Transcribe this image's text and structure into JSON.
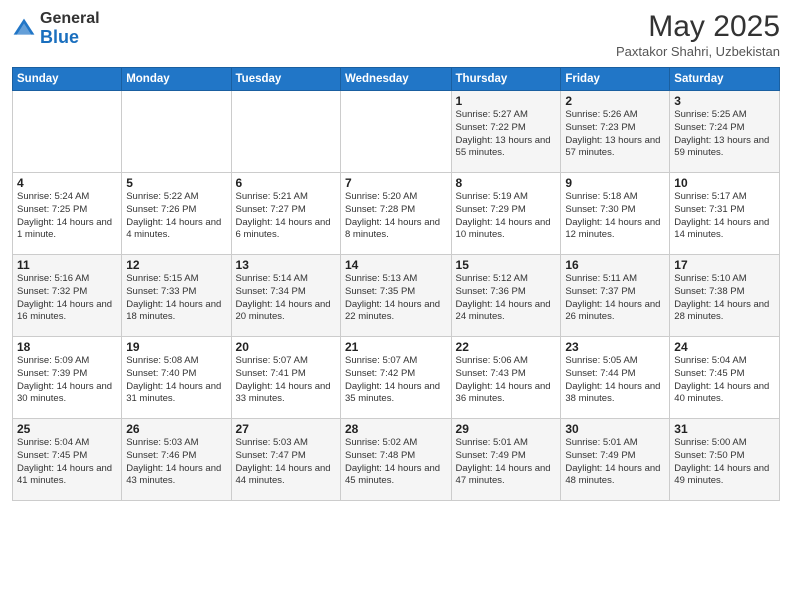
{
  "logo": {
    "general": "General",
    "blue": "Blue"
  },
  "title": "May 2025",
  "subtitle": "Paxtakor Shahri, Uzbekistan",
  "days_header": [
    "Sunday",
    "Monday",
    "Tuesday",
    "Wednesday",
    "Thursday",
    "Friday",
    "Saturday"
  ],
  "weeks": [
    [
      {
        "day": "",
        "sunrise": "",
        "sunset": "",
        "daylight": ""
      },
      {
        "day": "",
        "sunrise": "",
        "sunset": "",
        "daylight": ""
      },
      {
        "day": "",
        "sunrise": "",
        "sunset": "",
        "daylight": ""
      },
      {
        "day": "",
        "sunrise": "",
        "sunset": "",
        "daylight": ""
      },
      {
        "day": "1",
        "sunrise": "5:27 AM",
        "sunset": "7:22 PM",
        "daylight": "13 hours and 55 minutes."
      },
      {
        "day": "2",
        "sunrise": "5:26 AM",
        "sunset": "7:23 PM",
        "daylight": "13 hours and 57 minutes."
      },
      {
        "day": "3",
        "sunrise": "5:25 AM",
        "sunset": "7:24 PM",
        "daylight": "13 hours and 59 minutes."
      }
    ],
    [
      {
        "day": "4",
        "sunrise": "5:24 AM",
        "sunset": "7:25 PM",
        "daylight": "14 hours and 1 minute."
      },
      {
        "day": "5",
        "sunrise": "5:22 AM",
        "sunset": "7:26 PM",
        "daylight": "14 hours and 4 minutes."
      },
      {
        "day": "6",
        "sunrise": "5:21 AM",
        "sunset": "7:27 PM",
        "daylight": "14 hours and 6 minutes."
      },
      {
        "day": "7",
        "sunrise": "5:20 AM",
        "sunset": "7:28 PM",
        "daylight": "14 hours and 8 minutes."
      },
      {
        "day": "8",
        "sunrise": "5:19 AM",
        "sunset": "7:29 PM",
        "daylight": "14 hours and 10 minutes."
      },
      {
        "day": "9",
        "sunrise": "5:18 AM",
        "sunset": "7:30 PM",
        "daylight": "14 hours and 12 minutes."
      },
      {
        "day": "10",
        "sunrise": "5:17 AM",
        "sunset": "7:31 PM",
        "daylight": "14 hours and 14 minutes."
      }
    ],
    [
      {
        "day": "11",
        "sunrise": "5:16 AM",
        "sunset": "7:32 PM",
        "daylight": "14 hours and 16 minutes."
      },
      {
        "day": "12",
        "sunrise": "5:15 AM",
        "sunset": "7:33 PM",
        "daylight": "14 hours and 18 minutes."
      },
      {
        "day": "13",
        "sunrise": "5:14 AM",
        "sunset": "7:34 PM",
        "daylight": "14 hours and 20 minutes."
      },
      {
        "day": "14",
        "sunrise": "5:13 AM",
        "sunset": "7:35 PM",
        "daylight": "14 hours and 22 minutes."
      },
      {
        "day": "15",
        "sunrise": "5:12 AM",
        "sunset": "7:36 PM",
        "daylight": "14 hours and 24 minutes."
      },
      {
        "day": "16",
        "sunrise": "5:11 AM",
        "sunset": "7:37 PM",
        "daylight": "14 hours and 26 minutes."
      },
      {
        "day": "17",
        "sunrise": "5:10 AM",
        "sunset": "7:38 PM",
        "daylight": "14 hours and 28 minutes."
      }
    ],
    [
      {
        "day": "18",
        "sunrise": "5:09 AM",
        "sunset": "7:39 PM",
        "daylight": "14 hours and 30 minutes."
      },
      {
        "day": "19",
        "sunrise": "5:08 AM",
        "sunset": "7:40 PM",
        "daylight": "14 hours and 31 minutes."
      },
      {
        "day": "20",
        "sunrise": "5:07 AM",
        "sunset": "7:41 PM",
        "daylight": "14 hours and 33 minutes."
      },
      {
        "day": "21",
        "sunrise": "5:07 AM",
        "sunset": "7:42 PM",
        "daylight": "14 hours and 35 minutes."
      },
      {
        "day": "22",
        "sunrise": "5:06 AM",
        "sunset": "7:43 PM",
        "daylight": "14 hours and 36 minutes."
      },
      {
        "day": "23",
        "sunrise": "5:05 AM",
        "sunset": "7:44 PM",
        "daylight": "14 hours and 38 minutes."
      },
      {
        "day": "24",
        "sunrise": "5:04 AM",
        "sunset": "7:45 PM",
        "daylight": "14 hours and 40 minutes."
      }
    ],
    [
      {
        "day": "25",
        "sunrise": "5:04 AM",
        "sunset": "7:45 PM",
        "daylight": "14 hours and 41 minutes."
      },
      {
        "day": "26",
        "sunrise": "5:03 AM",
        "sunset": "7:46 PM",
        "daylight": "14 hours and 43 minutes."
      },
      {
        "day": "27",
        "sunrise": "5:03 AM",
        "sunset": "7:47 PM",
        "daylight": "14 hours and 44 minutes."
      },
      {
        "day": "28",
        "sunrise": "5:02 AM",
        "sunset": "7:48 PM",
        "daylight": "14 hours and 45 minutes."
      },
      {
        "day": "29",
        "sunrise": "5:01 AM",
        "sunset": "7:49 PM",
        "daylight": "14 hours and 47 minutes."
      },
      {
        "day": "30",
        "sunrise": "5:01 AM",
        "sunset": "7:49 PM",
        "daylight": "14 hours and 48 minutes."
      },
      {
        "day": "31",
        "sunrise": "5:00 AM",
        "sunset": "7:50 PM",
        "daylight": "14 hours and 49 minutes."
      }
    ]
  ]
}
